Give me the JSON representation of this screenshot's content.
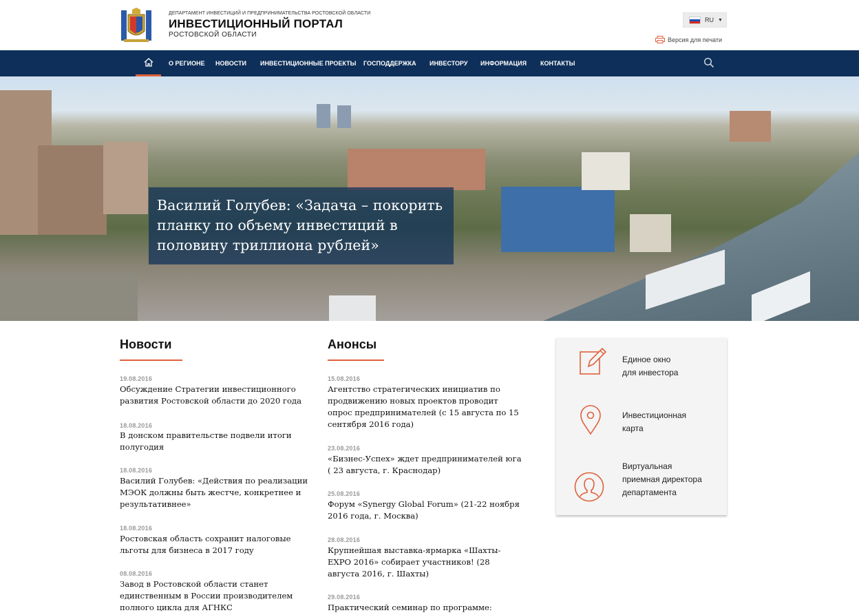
{
  "header": {
    "department": "Департамент инвестиций и предпринимательства Ростовской области",
    "title": "ИНВЕСТИЦИОННЫЙ ПОРТАЛ",
    "subtitle": "РОСТОВСКОЙ ОБЛАСТИ",
    "lang": "RU",
    "print_label": "Версия для печати"
  },
  "nav": {
    "items": [
      "О РЕГИОНЕ",
      "НОВОСТИ",
      "ИНВЕСТИЦИОННЫЕ ПРОЕКТЫ",
      "ГОСПОДДЕРЖКА",
      "ИНВЕСТОРУ",
      "ИНФОРМАЦИЯ",
      "КОНТАКТЫ"
    ]
  },
  "hero": {
    "caption": "Василий Голубев: «Задача – покорить планку по объему инвестиций в половину триллиона рублей»"
  },
  "news": {
    "title": "Новости",
    "items": [
      {
        "date": "19.08.2016",
        "title": "Обсуждение Стратегии инвестиционного развития Ростовской области до 2020 года"
      },
      {
        "date": "18.08.2016",
        "title": "В донском правительстве подвели итоги полугодия"
      },
      {
        "date": "18.08.2016",
        "title": "Василий Голубев: «Действия по реализации МЭОК должны быть жестче, конкретнее и результативнее»"
      },
      {
        "date": "18.08.2016",
        "title": "Ростовская область сохранит налоговые льготы для бизнеса в 2017 году"
      },
      {
        "date": "08.08.2016",
        "title": "Завод в Ростовской области станет единственным в России производителем полного цикла для АГНКС"
      }
    ]
  },
  "announcements": {
    "title": "Анонсы",
    "items": [
      {
        "date": "15.08.2016",
        "title": "Агентство стратегических инициатив по продвижению новых проектов проводит опрос предпринимателей (с 15 августа по 15 сентября 2016 года)"
      },
      {
        "date": "23.08.2016",
        "title": "«Бизнес-Успех» ждет предпринимателей юга ( 23 августа, г. Краснодар)"
      },
      {
        "date": "25.08.2016",
        "title": "Форум «Synergy Global Forum» (21-22 ноября 2016 года, г. Москва)"
      },
      {
        "date": "28.08.2016",
        "title": "Крупнейшая выставка-ярмарка «Шахты-EXPO 2016» собирает участников! (28 августа 2016, г. Шахты)"
      },
      {
        "date": "29.08.2016",
        "title": "Практический семинар по программе:"
      }
    ]
  },
  "side": {
    "items": [
      {
        "label_line1": "Единое окно",
        "label_line2": "для инвестора",
        "label_line3": "",
        "icon": "edit-icon"
      },
      {
        "label_line1": "Инвестиционная",
        "label_line2": "карта",
        "label_line3": "",
        "icon": "map-pin-icon"
      },
      {
        "label_line1": "Виртуальная",
        "label_line2": "приемная директора",
        "label_line3": "департамента",
        "icon": "user-icon"
      }
    ]
  },
  "colors": {
    "nav_bg": "#0e2f59",
    "accent": "#e0603a"
  }
}
